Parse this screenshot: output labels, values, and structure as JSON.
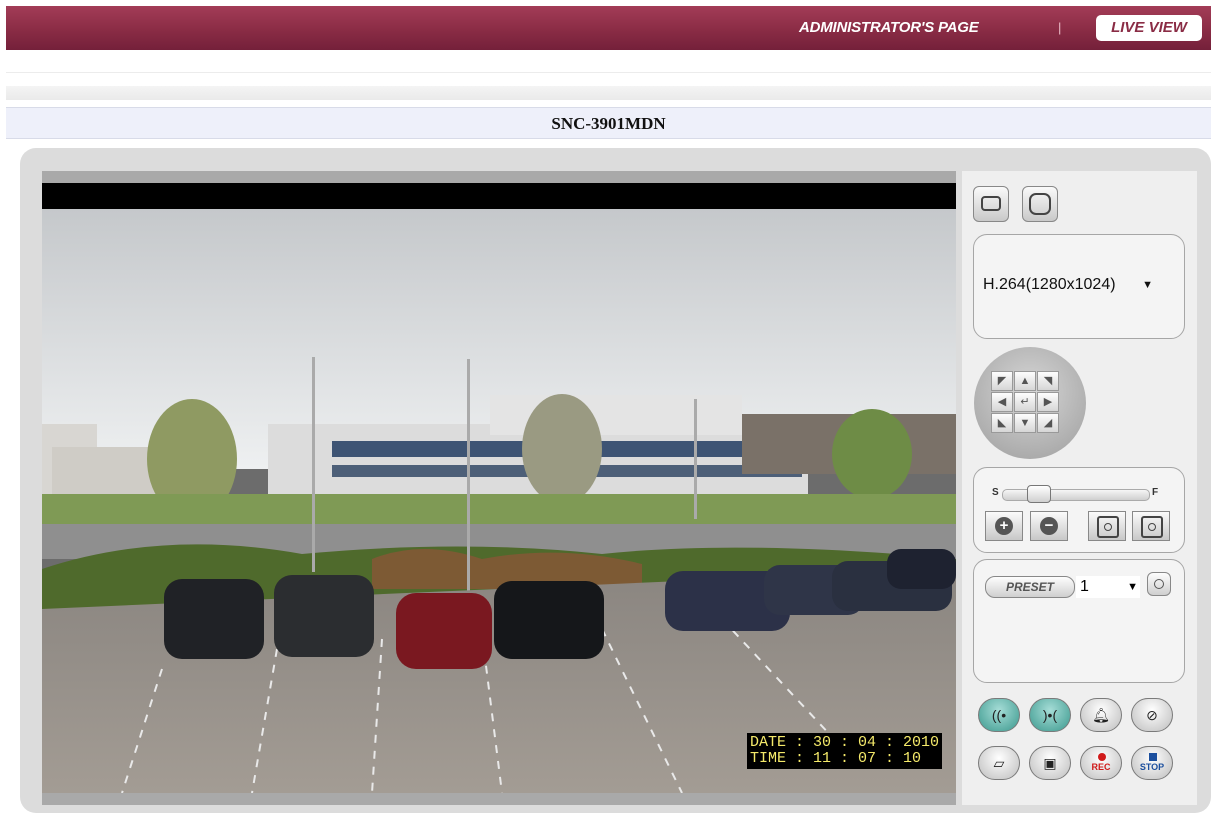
{
  "header": {
    "admin_link": "ADMINISTRATOR'S PAGE",
    "separator": "|",
    "live_view": "LIVE VIEW",
    "brand_color": "#8a2c45"
  },
  "camera": {
    "model": "SNC-3901MDN"
  },
  "video": {
    "osd_date": "DATE : 30 : 04 : 2010",
    "osd_time": "TIME : 11 : 07 : 10"
  },
  "controls": {
    "view_buttons": [
      "frame-icon",
      "fullscreen-icon"
    ],
    "codec": {
      "selected": "H.264(1280x1024)"
    },
    "ptz": {
      "keys": [
        "up-left",
        "up",
        "up-right",
        "left",
        "home",
        "right",
        "down-left",
        "down",
        "down-right"
      ]
    },
    "focus": {
      "near_label": "S",
      "far_label": "F",
      "buttons": [
        "zoom-in-icon",
        "zoom-out-icon",
        "focus-near-icon",
        "focus-far-icon"
      ]
    },
    "preset": {
      "button_label": "PRESET",
      "selected": "1"
    },
    "bottom_buttons": {
      "row1": [
        "audio-icon",
        "talk-icon",
        "alarm-bell-icon",
        "alarm-off-icon"
      ],
      "row2": [
        "capture-frame-icon",
        "camera-icon",
        "rec",
        "stop"
      ],
      "rec_label": "REC",
      "stop_label": "STOP",
      "accent_teal": "#3c998e"
    }
  }
}
